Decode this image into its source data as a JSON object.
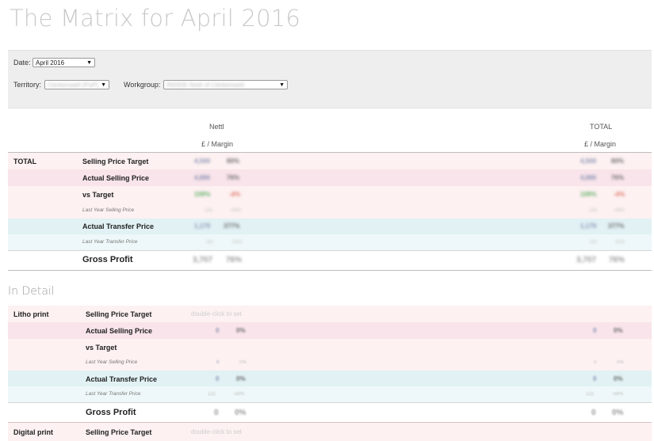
{
  "title": "The Matrix for April 2016",
  "filters": {
    "date_label": "Date:",
    "date_value": "April 2016",
    "territory_label": "Territory:",
    "territory_value": "Clerkenwell (PoP)",
    "workgroup_label": "Workgroup:",
    "workgroup_value": "INSIDE Nettl of Clerkenwell"
  },
  "columns": {
    "col1": "Nettl",
    "col2": "TOTAL",
    "sub1": "£ / Margin",
    "sub2": "£ / Margin"
  },
  "total": {
    "section": "TOTAL",
    "rows": [
      {
        "label": "Selling Price Target",
        "v1": "4,500",
        "p1": "80%",
        "v2": "4,500",
        "p2": "80%"
      },
      {
        "label": "Actual Selling Price",
        "v1": "4,886",
        "p1": "76%",
        "v2": "4,886",
        "p2": "76%"
      },
      {
        "label": "vs Target",
        "v1": "109%",
        "p1": "-4%",
        "v2": "109%",
        "p2": "-4%"
      },
      {
        "label": "Last Year Selling Price",
        "v1": "135",
        "p1": "-49%",
        "v2": "135",
        "p2": "-49%"
      },
      {
        "label": "Actual Transfer Price",
        "v1": "1,179",
        "p1": "377%",
        "v2": "1,179",
        "p2": "377%"
      },
      {
        "label": "Last Year Transfer Price",
        "v1": "187",
        "p1": "31%",
        "v2": "187",
        "p2": "31%"
      },
      {
        "label": "Gross Profit",
        "v1": "3,707",
        "p1": "76%",
        "v2": "3,707",
        "p2": "76%"
      }
    ]
  },
  "in_detail": {
    "heading": "In Detail",
    "hint": "double-click to set",
    "groups": [
      {
        "section": "Litho print",
        "rows": [
          {
            "label": "Selling Price Target"
          },
          {
            "label": "Actual Selling Price",
            "v1": "0",
            "p1": "0%",
            "v2": "0",
            "p2": "0%"
          },
          {
            "label": "vs Target"
          },
          {
            "label": "Last Year Selling Price",
            "v1": "0",
            "p1": "0%",
            "v2": "0",
            "p2": "0%"
          },
          {
            "label": "Actual Transfer Price",
            "v1": "0",
            "p1": "0%",
            "v2": "0",
            "p2": "0%"
          },
          {
            "label": "Last Year Transfer Price",
            "v1": "122",
            "p1": "-58%",
            "v2": "122",
            "p2": "-58%"
          },
          {
            "label": "Gross Profit",
            "v1": "0",
            "p1": "0%",
            "v2": "0",
            "p2": "0%"
          }
        ]
      },
      {
        "section": "Digital print",
        "rows": [
          {
            "label": "Selling Price Target"
          }
        ]
      }
    ]
  }
}
